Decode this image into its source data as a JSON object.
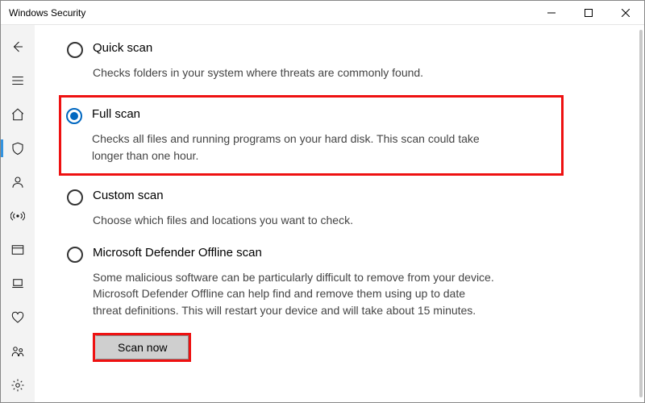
{
  "window": {
    "title": "Windows Security"
  },
  "scan_options": {
    "quick": {
      "title": "Quick scan",
      "desc": "Checks folders in your system where threats are commonly found."
    },
    "full": {
      "title": "Full scan",
      "desc": "Checks all files and running programs on your hard disk. This scan could take longer than one hour."
    },
    "custom": {
      "title": "Custom scan",
      "desc": "Choose which files and locations you want to check."
    },
    "offline": {
      "title": "Microsoft Defender Offline scan",
      "desc": "Some malicious software can be particularly difficult to remove from your device. Microsoft Defender Offline can help find and remove them using up to date threat definitions. This will restart your device and will take about 15 minutes."
    }
  },
  "selected_option": "full",
  "buttons": {
    "scan_now": "Scan now"
  }
}
